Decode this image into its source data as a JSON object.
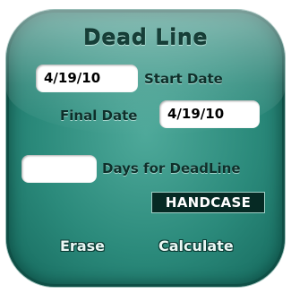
{
  "app": {
    "title": "Dead Line"
  },
  "start_date": {
    "value": "4/19/10",
    "label": "Start Date"
  },
  "final_date": {
    "label": "Final Date",
    "value": "4/19/10"
  },
  "days": {
    "value": "",
    "label": "Days for DeadLine"
  },
  "brand": {
    "label": "HANDCASE"
  },
  "actions": {
    "erase_label": "Erase",
    "calculate_label": "Calculate"
  },
  "colors": {
    "panel": "#2b8a7b",
    "panel_dark": "#15695d",
    "title_text": "#163f38",
    "badge_bg": "#062a24"
  }
}
